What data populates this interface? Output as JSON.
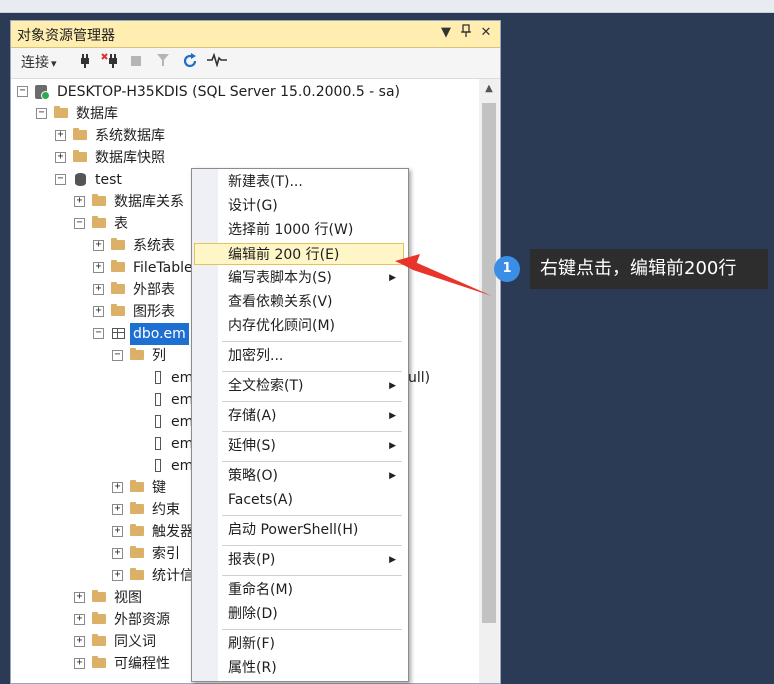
{
  "panel": {
    "title": "对象资源管理器",
    "title_buttons": [
      "▼",
      "📌",
      "✕"
    ],
    "toolbar": {
      "connect_label": "连接",
      "connect_caret": "▾"
    }
  },
  "tree": {
    "server": "DESKTOP-H35KDIS (SQL Server 15.0.2000.5 - sa)",
    "databases": "数据库",
    "system_databases": "系统数据库",
    "db_snapshots": "数据库快照",
    "db_test": "test",
    "db_diagrams": "数据库关系",
    "tables": "表",
    "system_tables": "系统表",
    "file_tables": "FileTable",
    "external_tables": "外部表",
    "graph_tables": "图形表",
    "selected_table": "dbo.em",
    "columns": "列",
    "col_items": [
      "em",
      "em",
      "em",
      "em",
      "em"
    ],
    "col_partial_suffix": "ull)",
    "keys": "键",
    "constraints": "约束",
    "triggers": "触发器",
    "indexes": "索引",
    "statistics": "统计信",
    "views": "视图",
    "external_resources": "外部资源",
    "synonyms": "同义词",
    "programmability": "可编程性"
  },
  "context_menu": {
    "items": [
      {
        "label": "新建表(T)...",
        "submenu": false
      },
      {
        "label": "设计(G)",
        "submenu": false
      },
      {
        "label": "选择前 1000 行(W)",
        "submenu": false
      },
      {
        "label": "编辑前 200 行(E)",
        "submenu": false,
        "highlighted": true
      },
      {
        "label": "编写表脚本为(S)",
        "submenu": true
      },
      {
        "label": "查看依赖关系(V)",
        "submenu": false
      },
      {
        "label": "内存优化顾问(M)",
        "submenu": false
      },
      {
        "label": "加密列...",
        "submenu": false
      },
      {
        "label": "全文检索(T)",
        "submenu": true
      },
      {
        "label": "存储(A)",
        "submenu": true
      },
      {
        "label": "延伸(S)",
        "submenu": true
      },
      {
        "label": "策略(O)",
        "submenu": true
      },
      {
        "label": "Facets(A)",
        "submenu": false
      },
      {
        "label": "启动 PowerShell(H)",
        "submenu": false
      },
      {
        "label": "报表(P)",
        "submenu": true
      },
      {
        "label": "重命名(M)",
        "submenu": false
      },
      {
        "label": "删除(D)",
        "submenu": false
      },
      {
        "label": "刷新(F)",
        "submenu": false
      },
      {
        "label": "属性(R)",
        "submenu": false
      }
    ],
    "submenu_arrow": "▶"
  },
  "annotation": {
    "step_number": "1",
    "text": "右键点击，编辑前200行",
    "arrow_color": "#e8342a"
  }
}
